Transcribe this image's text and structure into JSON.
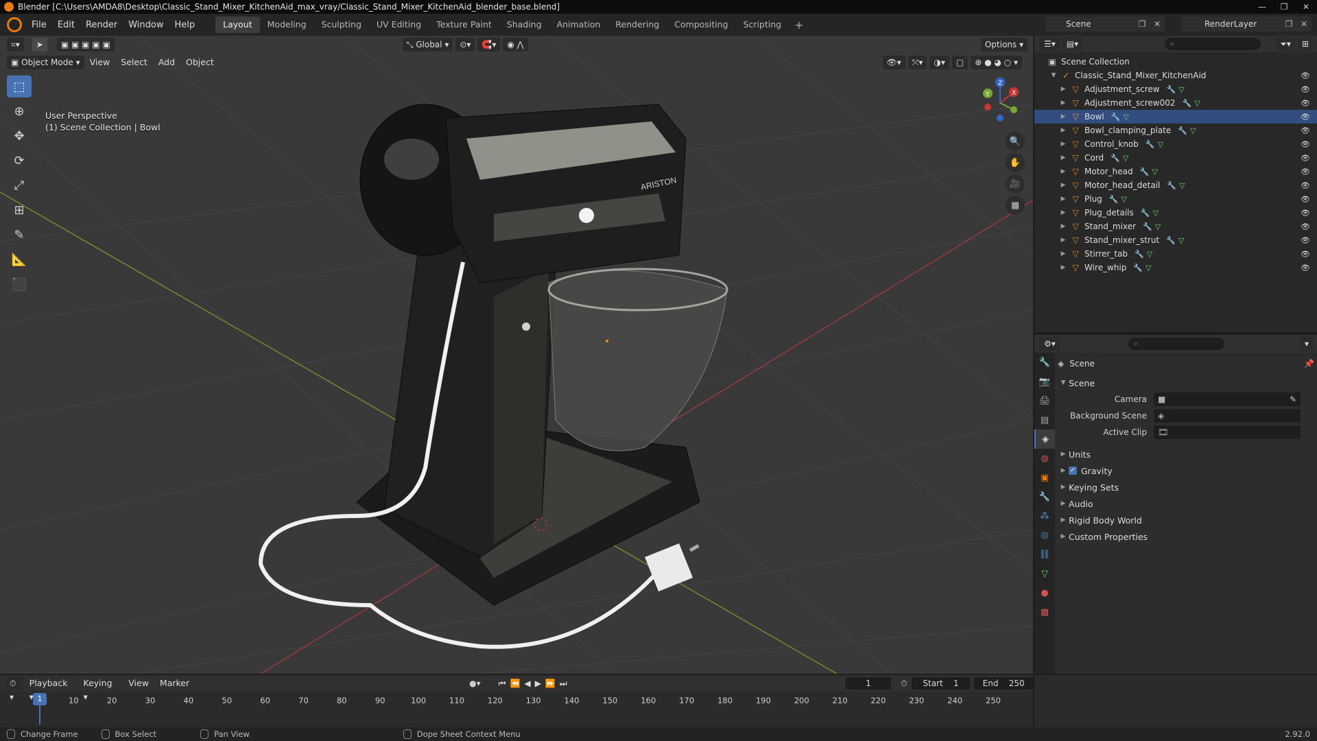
{
  "title_bar": {
    "text": "Blender [C:\\Users\\AMDA8\\Desktop\\Classic_Stand_Mixer_KitchenAid_max_vray/Classic_Stand_Mixer_KitchenAid_blender_base.blend]",
    "controls": [
      "—",
      "❐",
      "✕"
    ]
  },
  "menu": {
    "items": [
      "File",
      "Edit",
      "Render",
      "Window",
      "Help"
    ],
    "workspaces": [
      "Layout",
      "Modeling",
      "Sculpting",
      "UV Editing",
      "Texture Paint",
      "Shading",
      "Animation",
      "Rendering",
      "Compositing",
      "Scripting"
    ],
    "active_workspace": "Layout",
    "add_symbol": "+",
    "scene": "Scene",
    "render_layer": "RenderLayer"
  },
  "viewport": {
    "transform_orientation": "Global",
    "options_label": "Options",
    "mode": "Object Mode",
    "menus": [
      "View",
      "Select",
      "Add",
      "Object"
    ],
    "info_line1": "User Perspective",
    "info_line2": "(1) Scene Collection | Bowl",
    "brand_text": "ARISTON",
    "gizmo_axes": [
      "X",
      "Y",
      "Z"
    ]
  },
  "outliner": {
    "root": "Scene Collection",
    "collection": "Classic_Stand_Mixer_KitchenAid",
    "objects": [
      "Adjustment_screw",
      "Adjustment_screw002",
      "Bowl",
      "Bowl_clamping_plate",
      "Control_knob",
      "Cord",
      "Motor_head",
      "Motor_head_detail",
      "Plug",
      "Plug_details",
      "Stand_mixer",
      "Stand_mixer_strut",
      "Stirrer_tab",
      "Wire_whip"
    ],
    "selected": "Bowl"
  },
  "properties": {
    "context": "Scene",
    "panel": "Scene",
    "fields": [
      {
        "label": "Camera",
        "value": ""
      },
      {
        "label": "Background Scene",
        "value": ""
      },
      {
        "label": "Active Clip",
        "value": ""
      }
    ],
    "sections": [
      "Units",
      "Gravity",
      "Keying Sets",
      "Audio",
      "Rigid Body World",
      "Custom Properties"
    ],
    "gravity_checked": true
  },
  "timeline": {
    "menus": [
      "Playback",
      "Keying",
      "View",
      "Marker"
    ],
    "current_frame": "1",
    "start_label": "Start",
    "start": "1",
    "end_label": "End",
    "end": "250",
    "ticks": [
      "10",
      "20",
      "30",
      "40",
      "50",
      "60",
      "70",
      "80",
      "90",
      "100",
      "110",
      "120",
      "130",
      "140",
      "150",
      "160",
      "170",
      "180",
      "190",
      "200",
      "210",
      "220",
      "230",
      "240",
      "250"
    ]
  },
  "statusbar": {
    "items": [
      "Change Frame",
      "Box Select",
      "Pan View",
      "Dope Sheet Context Menu"
    ],
    "version": "2.92.0"
  },
  "colors": {
    "accent": "#4772b3",
    "blender_orange": "#e87d0d",
    "grid_bg": "#393939"
  }
}
